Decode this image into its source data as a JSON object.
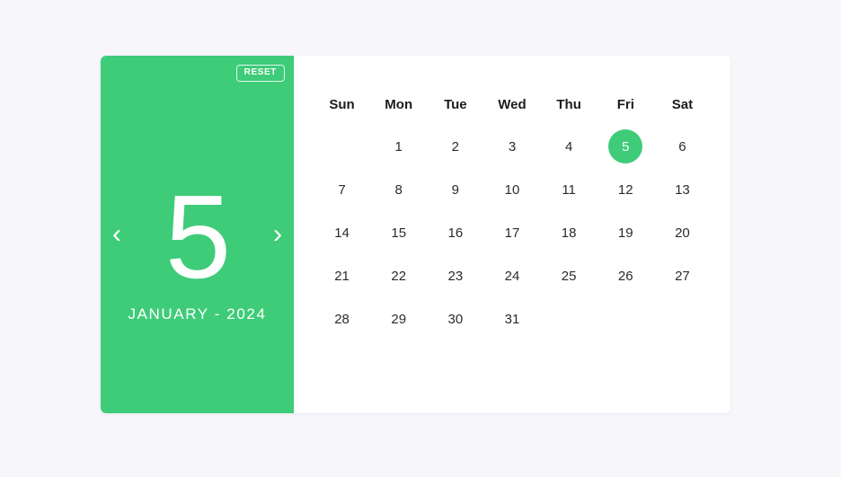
{
  "theme": {
    "accent": "#3ecc79",
    "page_background": "#f7f6fb",
    "card_background": "#ffffff",
    "text": "#2b2b2b"
  },
  "side_panel": {
    "reset_label": "RESET",
    "prev_icon": "chevron-left-icon",
    "next_icon": "chevron-right-icon",
    "prev_glyph": "‹",
    "next_glyph": "›",
    "selected_day": "5",
    "month_year": "JANUARY - 2024"
  },
  "calendar": {
    "weekdays": [
      "Sun",
      "Mon",
      "Tue",
      "Wed",
      "Thu",
      "Fri",
      "Sat"
    ],
    "selected_date": 5,
    "weeks": [
      [
        "",
        "1",
        "2",
        "3",
        "4",
        "5",
        "6"
      ],
      [
        "7",
        "8",
        "9",
        "10",
        "11",
        "12",
        "13"
      ],
      [
        "14",
        "15",
        "16",
        "17",
        "18",
        "19",
        "20"
      ],
      [
        "21",
        "22",
        "23",
        "24",
        "25",
        "26",
        "27"
      ],
      [
        "28",
        "29",
        "30",
        "31",
        "",
        "",
        ""
      ]
    ]
  }
}
